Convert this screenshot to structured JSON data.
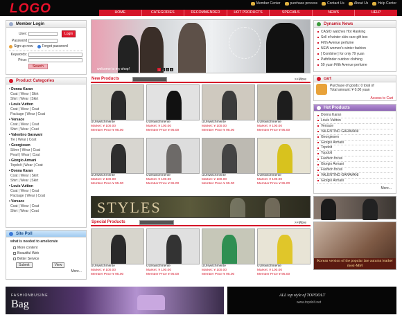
{
  "header": {
    "logo": "LOGO",
    "top_links": [
      "Member Center",
      "purchase process",
      "Contact Us",
      "About Us",
      "Help Center"
    ],
    "nav": [
      "HOME",
      "CATEGORIES",
      "RECOMMENDED",
      "HOT PRODUCTS",
      "SPECIALS",
      "NEWS",
      "HELP"
    ]
  },
  "login": {
    "title": "Member Login",
    "user_label": "User:",
    "password_label": "Password",
    "login_button": "Login",
    "signup": "Sign up now",
    "forgot": "Forgot password",
    "keywords_label": "Keywords:",
    "price_label": "Price:",
    "search_button": "Search"
  },
  "categories": {
    "title": "Product Categories",
    "brands": [
      {
        "name": "Donna Karan",
        "subs": [
          "Coat | Wear | Skirt",
          "Shirt | Wear | Skirt"
        ]
      },
      {
        "name": "Louis Vuitton",
        "subs": [
          "Coat | Wear | Coat",
          "Package | Wear | Coat"
        ]
      },
      {
        "name": "Versace",
        "subs": [
          "Coat | Wear | Coat",
          "Shirt | Wear | Coat"
        ]
      },
      {
        "name": "Valentino Garavani",
        "subs": [
          "Tie | Wear | Coat"
        ]
      },
      {
        "name": "Georgiesen",
        "subs": [
          "Silver | Wear | Coat",
          "Pearl | Wear | Coat"
        ]
      },
      {
        "name": "Giorgio Armani",
        "subs": [
          "Topdolt | Wear | Coat"
        ]
      },
      {
        "name": "Donna Karan",
        "subs": [
          "Coat | Wear | Skirt",
          "Shirt | Wear | Skirt"
        ]
      },
      {
        "name": "Louis Vuitton",
        "subs": [
          "Coat | Wear | Coat",
          "Package | Wear | Coat"
        ]
      },
      {
        "name": "Versace",
        "subs": [
          "Coat | Wear | Coat",
          "Shirt | Wear | Coat"
        ]
      }
    ]
  },
  "poll": {
    "title": "Site Poll",
    "question": "what is needed to ameliorate",
    "options": [
      "More content",
      "Beautiful Web",
      "Better Service"
    ],
    "submit": "Submit",
    "view": "View",
    "more": "More..."
  },
  "banner": {
    "caption": "welcome to my shop!",
    "dots": [
      "1",
      "2",
      "3",
      "4"
    ]
  },
  "news": {
    "title": "Dynamic News",
    "items": [
      "CASIO watches Hot Ranking",
      "Sell of winter skin care gift box",
      "Fifth Avenue perfume",
      "NEW women's winter fashion",
      "[ Combine ] for only 79 yuan",
      "Pathfinder outdoor clothing",
      "59 yuan Fifth Avenue perfume"
    ]
  },
  "cart": {
    "title": "cart",
    "line1": "Purchase of goods: 0 total of",
    "line2": "Total amount: ¥ 0.00 yuan",
    "link": "Access to Cart"
  },
  "hot_products": {
    "title": "Hot Products",
    "items": [
      "Donna Karan",
      "Louis Vuitton",
      "Versace",
      "VALENTINO GARAVANI",
      "Georgiesen",
      "Giorgio Armani",
      "Topdolt",
      "Topdolt",
      "Fashion focus",
      "Giorgio Armani",
      "Fashion focus",
      "VALENTINO GARAVANI",
      "Giorgio Armani"
    ],
    "more": "More..."
  },
  "new_products": {
    "title": "New Products",
    "more": ">>More",
    "name": "UU/switchmente",
    "market": "Market: ¥ 100.00",
    "member": "Member Price ¥ 95.00"
  },
  "special_products": {
    "title": "Special Products",
    "more": ">>More",
    "name": "UU/switchmente",
    "market": "Market: ¥ 100.00",
    "member": "Member Price ¥ 95.00"
  },
  "styles_banner": "STYLES",
  "autumn_ad": "Korean version of the popular late autumn leather most-MM",
  "footer": {
    "left_small": "FASHIONBUSINE",
    "left_big": "Bag",
    "right_line1": "ALL top style of TOPDOLT",
    "right_line2": "www.topdolt.net"
  },
  "colors": {
    "accent": "#d51428",
    "top_bar": "#080808"
  }
}
